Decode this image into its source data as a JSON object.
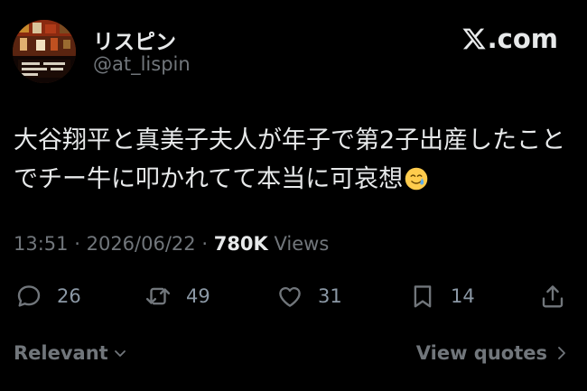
{
  "author": {
    "display_name": "リスピン",
    "handle": "@at_lispin",
    "avatar": "pixel-art-game-scene"
  },
  "brand": {
    "logo_text": ".com",
    "logo_icon": "x-logo-icon"
  },
  "tweet": {
    "lines": [
      "大谷翔平と真美子夫人が年子で第2子出産したこと",
      "でチー牛に叩かれてて本当に可哀想"
    ],
    "emoji": "smiling-face-with-tear-emoji"
  },
  "meta": {
    "time": "13:51",
    "date": "2026/06/22",
    "separator": "·",
    "views_count": "780K",
    "views_label": "Views"
  },
  "actions": {
    "replies": "26",
    "reposts": "49",
    "likes": "31",
    "bookmarks": "14"
  },
  "footer": {
    "sort_label": "Relevant",
    "view_quotes_label": "View quotes"
  },
  "colors": {
    "background": "#000000",
    "primary_text": "#e7e9ea",
    "secondary_text": "#71767b"
  }
}
